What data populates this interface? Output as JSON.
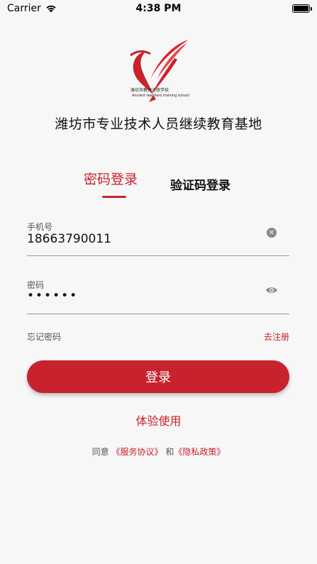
{
  "status_bar": {
    "carrier": "Carrier",
    "time": "4:38 PM"
  },
  "logo": {
    "school_name": "潍坊市教师进修学校",
    "school_name_en": "Ancient teachers training school"
  },
  "org_title": "潍坊市专业技术人员继续教育基地",
  "tabs": {
    "password_login": "密码登录",
    "code_login": "验证码登录"
  },
  "phone_field": {
    "label": "手机号",
    "value": "18663790011"
  },
  "password_field": {
    "label": "密码",
    "value": "••••••"
  },
  "links": {
    "forgot": "忘记密码",
    "register": "去注册"
  },
  "login_button": "登录",
  "trial_link": "体验使用",
  "agreement": {
    "prefix": "同意",
    "service": "《服务协议》",
    "and": "和",
    "privacy": "《隐私政策》"
  },
  "colors": {
    "accent": "#c8232c"
  }
}
